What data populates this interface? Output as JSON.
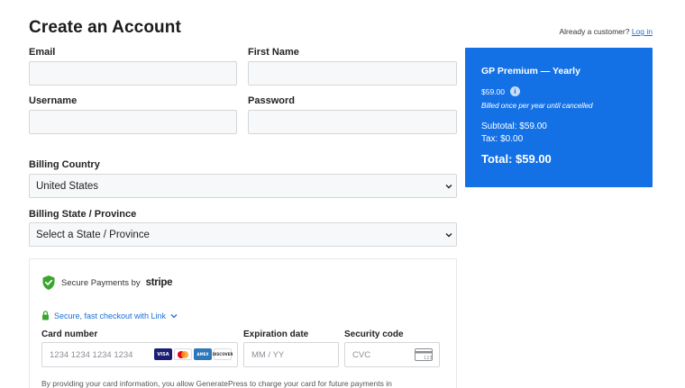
{
  "page": {
    "title": "Create an Account"
  },
  "header": {
    "already_text": "Already a customer?",
    "login_link": "Log in"
  },
  "form": {
    "email_label": "Email",
    "first_name_label": "First Name",
    "username_label": "Username",
    "password_label": "Password",
    "billing_country_label": "Billing Country",
    "billing_country_value": "United States",
    "billing_state_label": "Billing State / Province",
    "billing_state_value": "Select a State / Province"
  },
  "summary": {
    "plan": "GP Premium — Yearly",
    "price": "$59.00",
    "billed": "Billed once per year until cancelled",
    "subtotal": "Subtotal: $59.00",
    "tax": "Tax: $0.00",
    "total": "Total: $59.00"
  },
  "payment": {
    "secure_text": "Secure Payments by",
    "stripe_word": "stripe",
    "link_text": "Secure, fast checkout with Link",
    "card_number_label": "Card number",
    "card_number_placeholder": "1234 1234 1234 1234",
    "expiration_label": "Expiration date",
    "expiration_placeholder": "MM / YY",
    "security_label": "Security code",
    "security_placeholder": "CVC",
    "brands": [
      "VISA",
      "",
      "AMEX",
      "DISCOVER"
    ],
    "consent": "By providing your card information, you allow GeneratePress to charge your card for future payments in"
  },
  "colors": {
    "accent": "#1371e5",
    "link": "#1a6fd6",
    "shield": "#3aa52f"
  }
}
